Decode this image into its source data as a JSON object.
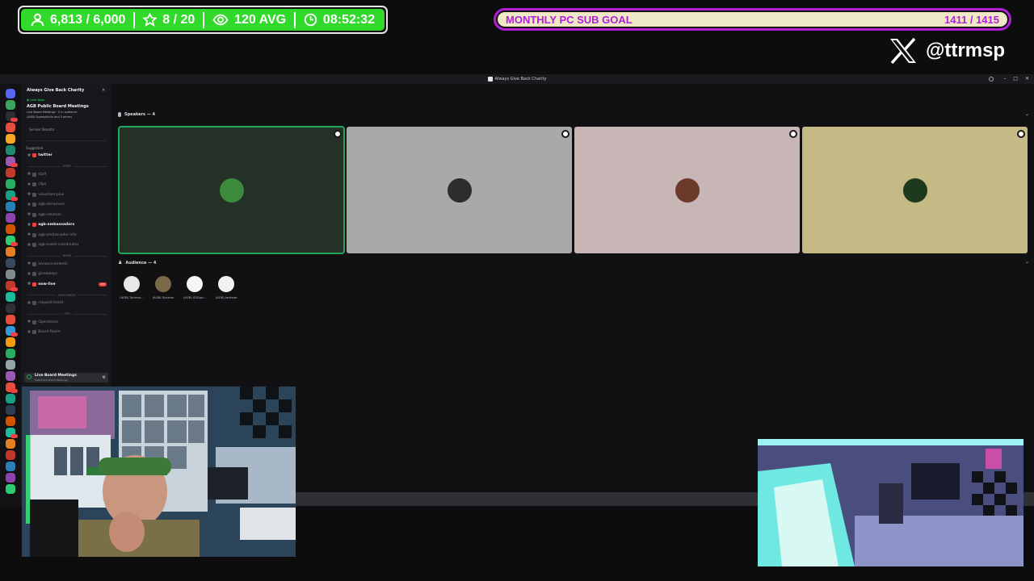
{
  "overlay": {
    "stats": [
      {
        "icon": "user-icon",
        "value": "6,813 / 6,000"
      },
      {
        "icon": "star-icon",
        "value": "8 / 20"
      },
      {
        "icon": "eye-icon",
        "value": "120 AVG"
      },
      {
        "icon": "clock-icon",
        "value": "08:52:32"
      }
    ],
    "goal": {
      "label": "MONTHLY PC SUB GOAL",
      "value": "1411 / 1415",
      "progress": 0.997
    },
    "social": {
      "icon": "x-logo-icon",
      "handle": "@ttrmsp"
    }
  },
  "colors": {
    "stats_green": "#31d92a",
    "goal_purple": "#b31fd6",
    "goal_fill": "#efe8c7",
    "discord_green": "#23a55a",
    "discord_red": "#f23f42"
  },
  "discord": {
    "window_title": "Always Give Back Charity",
    "guild_name": "Always Give Back Charity",
    "event": {
      "status": "● Live Now",
      "title": "AGB Public Board Meetings",
      "line1": "Live Board Meetings · 5 in audience",
      "line2": "(AGB) SpookyKnife and 3 others"
    },
    "server_boosts": "Server Boosts",
    "suggested_label": "Suggested",
    "channels": [
      {
        "name": "twitter",
        "bright": true,
        "badge": ""
      },
      {
        "category": "STAFF"
      },
      {
        "name": "staff"
      },
      {
        "name": "clips"
      },
      {
        "name": "volunteer-plus"
      },
      {
        "name": "agb-streamers"
      },
      {
        "name": "agb-creators"
      },
      {
        "name": "agb-ambassadors",
        "bright": true
      },
      {
        "name": "agb-ambassador-info"
      },
      {
        "name": "agb-event-coordinator"
      },
      {
        "category": "NEWS"
      },
      {
        "name": "announcements"
      },
      {
        "name": "giveaways"
      },
      {
        "name": "now-live",
        "bright": true,
        "badge": "100"
      },
      {
        "category": "RESOURCES"
      },
      {
        "name": "request-ticket"
      },
      {
        "category": "OPS"
      },
      {
        "name": "Operations"
      },
      {
        "name": "Board Room"
      }
    ],
    "voice": {
      "channel": "Live Board Meetings",
      "sub": "AGB Public Board Meetings",
      "user": "(AGB) SpookyKnife"
    },
    "speakers_label": "Speakers — 4",
    "audience_label": "Audience — 4",
    "audience": [
      {
        "name": "(AGB) Tohrmo...",
        "color": "#e8e8e8"
      },
      {
        "name": "(AGB) Spctron",
        "color": "#7a6a48"
      },
      {
        "name": "(AGB) SSGod...",
        "color": "#f5f5f5"
      },
      {
        "name": "(AGB) Jarhead",
        "color": "#f0f0f0"
      }
    ],
    "speaker_tiles": [
      {
        "bg": "#233127",
        "avatar": "#3c8a3c",
        "active": true
      },
      {
        "bg": "#a9a9a9",
        "avatar": "#2d2d2d",
        "active": false
      },
      {
        "bg": "#c8b6b6",
        "avatar": "#6b3a28",
        "active": false
      },
      {
        "bg": "#c5b985",
        "avatar": "#1e3a1e",
        "active": false
      }
    ]
  }
}
